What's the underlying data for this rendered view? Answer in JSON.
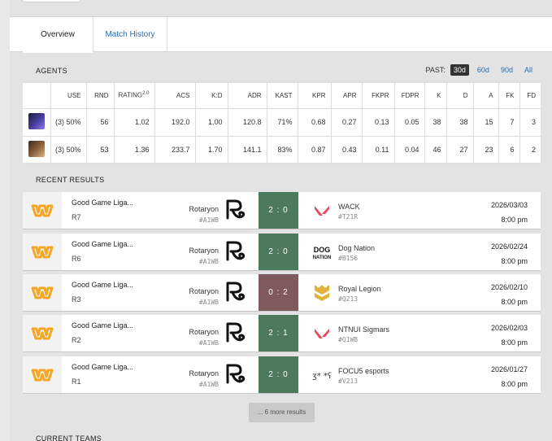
{
  "tabs": {
    "overview": "Overview",
    "history": "Match History"
  },
  "agents": {
    "heading": "AGENTS",
    "past_label": "PAST:",
    "ranges": [
      "30d",
      "60d",
      "90d",
      "All"
    ],
    "columns": [
      "",
      "USE",
      "RND",
      "RATING",
      "ACS",
      "K:D",
      "ADR",
      "KAST",
      "KPR",
      "APR",
      "FKPR",
      "FDPR",
      "K",
      "D",
      "A",
      "FK",
      "FD"
    ],
    "rating_sup": "2.0",
    "rows": [
      [
        "",
        "(3) 50%",
        "56",
        "1.02",
        "192.0",
        "1.00",
        "120.8",
        "71%",
        "0.68",
        "0.27",
        "0.13",
        "0.05",
        "38",
        "38",
        "15",
        "7",
        "3"
      ],
      [
        "",
        "(3) 50%",
        "53",
        "1.36",
        "233.7",
        "1.70",
        "141.1",
        "83%",
        "0.87",
        "0.43",
        "0.11",
        "0.04",
        "46",
        "27",
        "23",
        "6",
        "2"
      ]
    ]
  },
  "recent": {
    "heading": "RECENT RESULTS",
    "results": [
      {
        "event": "Good Game Liga...",
        "round": "R7",
        "team1": "Rotaryon",
        "team1_tag": "#A1WB",
        "score": "2 : 0",
        "outcome": "win",
        "team2": "WACK",
        "team2_tag": "#T21R",
        "date": "2026/03/03",
        "time": "8:00 pm",
        "team2_icon": "valorant-v-icon"
      },
      {
        "event": "Good Game Liga...",
        "round": "R6",
        "team1": "Rotaryon",
        "team1_tag": "#A1WB",
        "score": "2 : 0",
        "outcome": "win",
        "team2": "Dog Nation",
        "team2_tag": "#B156",
        "date": "2026/02/24",
        "time": "8:00 pm",
        "team2_icon": "dog-nation-logo"
      },
      {
        "event": "Good Game Liga...",
        "round": "R3",
        "team1": "Rotaryon",
        "team1_tag": "#A1WB",
        "score": "0 : 2",
        "outcome": "loss",
        "team2": "Royal Legion",
        "team2_tag": "#Q213",
        "date": "2026/02/10",
        "time": "8:00 pm",
        "team2_icon": "royal-legion-logo"
      },
      {
        "event": "Good Game Liga...",
        "round": "R2",
        "team1": "Rotaryon",
        "team1_tag": "#A1WB",
        "score": "2 : 1",
        "outcome": "win",
        "team2": "NTNUI Sigmars",
        "team2_tag": "#Q1WB",
        "date": "2026/02/03",
        "time": "8:00 pm",
        "team2_icon": "valorant-v-icon"
      },
      {
        "event": "Good Game Liga...",
        "round": "R1",
        "team1": "Rotaryon",
        "team1_tag": "#A1WB",
        "score": "2 : 0",
        "outcome": "win",
        "team2": "FOCU5 esports",
        "team2_tag": "#V213",
        "date": "2026/01/27",
        "time": "8:00 pm",
        "team2_icon": "focus-logo"
      }
    ],
    "more": "... 6 more results"
  },
  "current_teams": "CURRENT TEAMS",
  "colors": {
    "win": "#4d7a5c",
    "loss": "#7f5a5c",
    "link": "#2b6fb0",
    "event_logo": "#f5a623"
  },
  "dog_nation_logo_text": "DOG NATION"
}
